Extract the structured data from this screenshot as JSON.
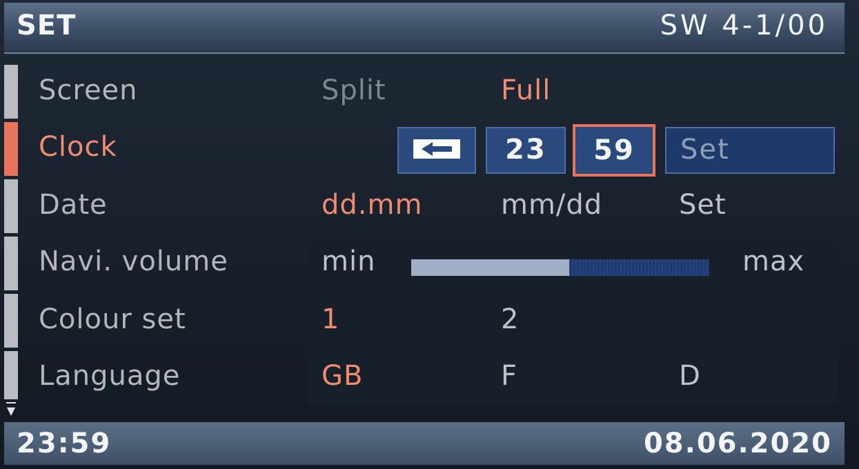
{
  "header": {
    "title": "SET",
    "version": "SW 4-1/00"
  },
  "rows": {
    "screen": {
      "label": "Screen",
      "options": [
        "Split",
        "Full"
      ],
      "selected": "Full"
    },
    "clock": {
      "label": "Clock",
      "back_icon": "back-arrow-icon",
      "hour": "23",
      "minute": "59",
      "set_label": "Set"
    },
    "date": {
      "label": "Date",
      "options": [
        "dd.mm",
        "mm/dd",
        "Set"
      ],
      "selected": "dd.mm"
    },
    "volume": {
      "label": "Navi. volume",
      "min_label": "min",
      "max_label": "max",
      "level_fraction": 0.53
    },
    "colour": {
      "label": "Colour set",
      "options": [
        "1",
        "2"
      ],
      "selected": "1"
    },
    "language": {
      "label": "Language",
      "options": [
        "GB",
        "F",
        "D"
      ],
      "selected": "GB"
    }
  },
  "active_row": "Clock",
  "colors": {
    "accent": "#e8745a",
    "selected_text": "#f08c70",
    "control_blue": "#2a4a7e"
  },
  "footer": {
    "time": "23:59",
    "date": "08.06.2020"
  }
}
